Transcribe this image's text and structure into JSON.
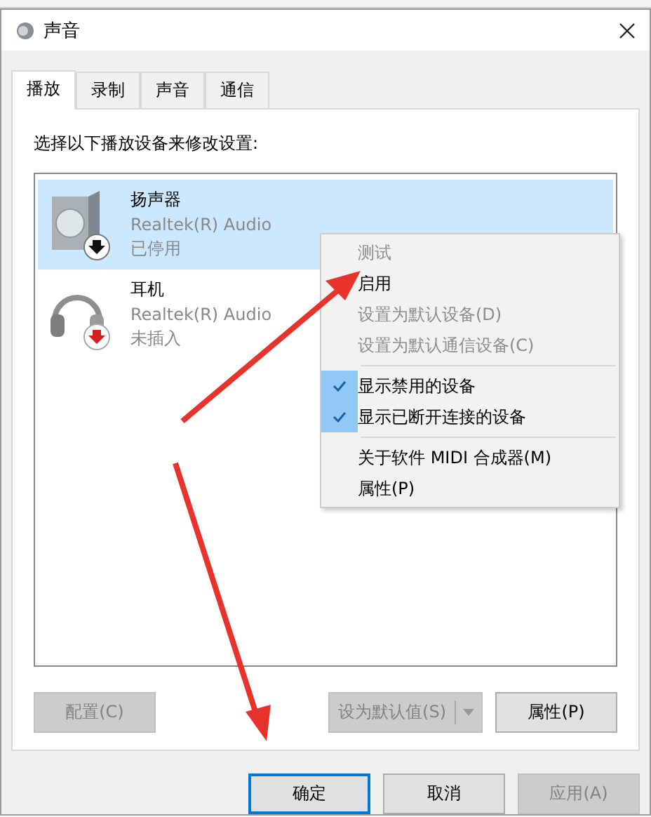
{
  "window": {
    "title": "声音"
  },
  "tabs": [
    {
      "label": "播放",
      "selected": true
    },
    {
      "label": "录制",
      "selected": false
    },
    {
      "label": "声音",
      "selected": false
    },
    {
      "label": "通信",
      "selected": false
    }
  ],
  "instruction": "选择以下播放设备来修改设置:",
  "devices": [
    {
      "name": "扬声器",
      "driver": "Realtek(R) Audio",
      "status": "已停用",
      "kind": "speaker",
      "selected": true
    },
    {
      "name": "耳机",
      "driver": "Realtek(R) Audio",
      "status": "未插入",
      "kind": "headphones",
      "selected": false
    }
  ],
  "context_menu": [
    {
      "kind": "item",
      "label": "测试",
      "disabled": true,
      "checked": false
    },
    {
      "kind": "item",
      "label": "启用",
      "disabled": false,
      "checked": false
    },
    {
      "kind": "item",
      "label": "设置为默认设备(D)",
      "disabled": true,
      "checked": false
    },
    {
      "kind": "item",
      "label": "设置为默认通信设备(C)",
      "disabled": true,
      "checked": false
    },
    {
      "kind": "separator"
    },
    {
      "kind": "item",
      "label": "显示禁用的设备",
      "disabled": false,
      "checked": true
    },
    {
      "kind": "item",
      "label": "显示已断开连接的设备",
      "disabled": false,
      "checked": true
    },
    {
      "kind": "separator"
    },
    {
      "kind": "item",
      "label": "关于软件 MIDI 合成器(M)",
      "disabled": false,
      "checked": false
    },
    {
      "kind": "item",
      "label": "属性(P)",
      "disabled": false,
      "checked": false
    }
  ],
  "panel_buttons": {
    "configure": {
      "label": "配置(C)",
      "disabled": true
    },
    "set_default": {
      "label": "设为默认值(S)",
      "disabled": true
    },
    "properties": {
      "label": "属性(P)",
      "disabled": false
    }
  },
  "dialog_buttons": [
    {
      "label": "确定",
      "disabled": false,
      "default": true
    },
    {
      "label": "取消",
      "disabled": false,
      "default": false
    },
    {
      "label": "应用(A)",
      "disabled": true,
      "default": false
    }
  ]
}
